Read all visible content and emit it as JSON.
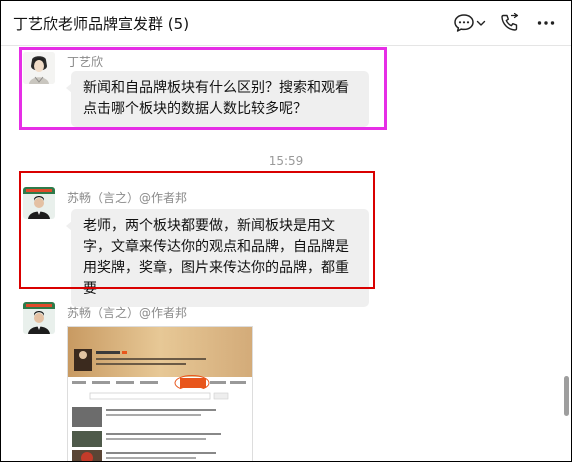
{
  "header": {
    "title": "丁艺欣老师品牌宣发群",
    "member_count": "(5)"
  },
  "messages": [
    {
      "sender": "丁艺欣",
      "text": "新闻和自品牌板块有什么区别？搜索和观看点击哪个板块的数据人数比较多呢？"
    },
    {
      "timestamp": "15:59"
    },
    {
      "sender": "苏畅（言之）@作者邦",
      "text": "老师，两个板块都要做，新闻板块是用文字，文章来传达你的观点和品牌，自品牌是用奖牌，奖章，图片来传达你的品牌，都重要"
    },
    {
      "sender": "苏畅（言之）@作者邦",
      "image": "screenshot-thumbnail"
    }
  ],
  "colors": {
    "highlight_magenta": "#e62ee6",
    "highlight_red": "#d90000",
    "bubble_bg": "#efefef",
    "accent_orange": "#e8561c"
  },
  "icons": {
    "chat_bubble": "chat-bubble-icon",
    "dropdown": "chevron-down-icon",
    "call": "phone-call-icon",
    "more": "more-dots-icon"
  }
}
